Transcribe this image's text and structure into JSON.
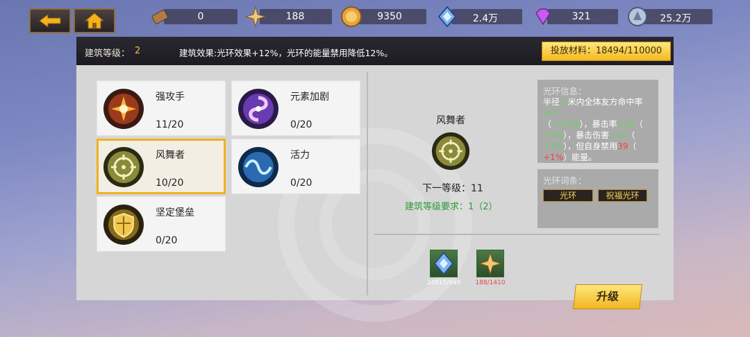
{
  "nav": {
    "back": "back",
    "home": "home"
  },
  "resources": [
    {
      "icon": "scroll-icon",
      "value": "0"
    },
    {
      "icon": "star-compass-icon",
      "value": "188"
    },
    {
      "icon": "gold-coin-icon",
      "value": "9350"
    },
    {
      "icon": "blue-crystal-icon",
      "value": "2.4万"
    },
    {
      "icon": "purple-diamond-icon",
      "value": "321"
    },
    {
      "icon": "silver-orb-icon",
      "value": "25.2万"
    }
  ],
  "header": {
    "level_label": "建筑等级：",
    "level_value": "2",
    "effect": "建筑效果:光环效果+12%，光环的能量禁用降低12%。",
    "material_label": "投放材料：18494/110000"
  },
  "skills": [
    {
      "name": "强攻手",
      "count": "11/20",
      "icon": "strike-icon"
    },
    {
      "name": "元素加剧",
      "count": "0/20",
      "icon": "element-swirl-icon"
    },
    {
      "name": "风舞者",
      "count": "10/20",
      "icon": "target-icon",
      "selected": true
    },
    {
      "name": "活力",
      "count": "0/20",
      "icon": "vitality-wave-icon"
    },
    {
      "name": "坚定堡垒",
      "count": "0/20",
      "icon": "shield-icon"
    }
  ],
  "detail": {
    "name": "风舞者",
    "next_level": "下一等级：11",
    "requirement": "建筑等级要求：1（2）"
  },
  "aura_info": {
    "title": "光环信息：",
    "lines": [
      [
        [
          "w",
          "半径 "
        ],
        [
          "g",
          "6"
        ],
        [
          "w",
          "米内全体友方命中率"
        ],
        [
          "g",
          "+6"
        ]
      ],
      [
        [
          "w",
          "（"
        ],
        [
          "g",
          "+0.5%"
        ],
        [
          "w",
          "），暴击率"
        ],
        [
          "g",
          "+10"
        ],
        [
          "w",
          "（"
        ]
      ],
      [
        [
          "g",
          "+1%"
        ],
        [
          "w",
          "），暴击伤害"
        ],
        [
          "g",
          "+30"
        ],
        [
          "w",
          "（"
        ]
      ],
      [
        [
          "g",
          "+1%"
        ],
        [
          "w",
          "），但自身禁用"
        ],
        [
          "r",
          "39"
        ],
        [
          "w",
          "（"
        ]
      ],
      [
        [
          "r",
          "+1%"
        ],
        [
          "w",
          "）能量。"
        ]
      ]
    ]
  },
  "aura_tags": {
    "title": "光环词条：",
    "tags": [
      "光环",
      "祝福光环"
    ]
  },
  "costs": [
    {
      "icon": "blue-crystal-icon",
      "value": "24915/940",
      "color": "#ffffff"
    },
    {
      "icon": "star-compass-icon",
      "value": "188/1410",
      "color": "#e84545"
    }
  ],
  "upgrade_label": "升级",
  "colors": {
    "accent": "#f2b21e",
    "green": "#2f9a3a",
    "red": "#e84545"
  }
}
